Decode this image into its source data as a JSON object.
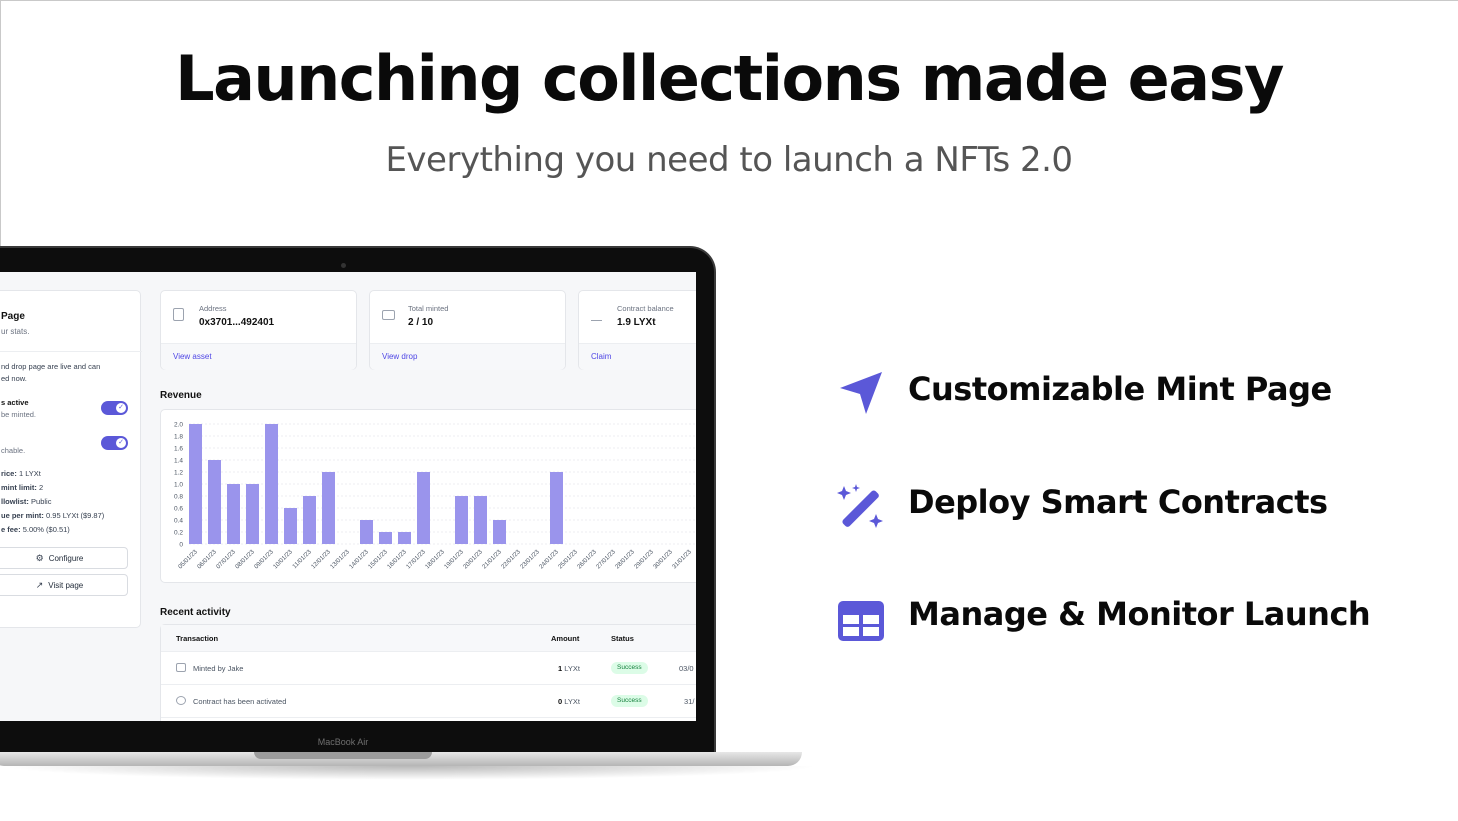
{
  "hero": {
    "title": "Launching collections made easy",
    "subtitle": "Everything you need to launch a NFTs 2.0"
  },
  "features": [
    {
      "label": "Customizable Mint Page",
      "icon": "navigation-arrow-icon"
    },
    {
      "label": "Deploy Smart Contracts",
      "icon": "magic-wand-icon"
    },
    {
      "label": "Manage & Monitor Launch",
      "icon": "grid-table-icon"
    }
  ],
  "colors": {
    "accent": "#5b58d8",
    "chart_bar": "#9a94ec",
    "link": "#4f46e5",
    "success_bg": "#dcfce7",
    "success_text": "#15803d"
  },
  "laptop": {
    "brand": "MacBook Air",
    "sidebar": {
      "title": "Page",
      "subtitle": "ur stats.",
      "intro_line1": "nd drop page are live and can",
      "intro_line2": "ed now.",
      "toggle1_label": "s active",
      "toggle1_sub": "be minted.",
      "toggle2_sub": "chable.",
      "price_key": "rice:",
      "price_val": "1 LYXt",
      "mint_limit_key": "mint limit:",
      "mint_limit_val": "2",
      "allowlist_key": "llowlist:",
      "allowlist_val": "Public",
      "revenue_key": "ue per mint:",
      "revenue_val": "0.95 LYXt ($9.87)",
      "fee_key": "e fee:",
      "fee_val": "5.00% ($0.51)",
      "configure_label": "Configure",
      "visit_label": "Visit page"
    },
    "stats": [
      {
        "label": "Address",
        "value": "0x3701...492401",
        "link": "View asset"
      },
      {
        "label": "Total minted",
        "value": "2 / 10",
        "link": "View drop"
      },
      {
        "label": "Contract balance",
        "value": "1.9 LYXt",
        "link": "Claim"
      }
    ],
    "revenue_title": "Revenue",
    "activity": {
      "title": "Recent activity",
      "headers": {
        "transaction": "Transaction",
        "amount": "Amount",
        "status": "Status"
      },
      "rows": [
        {
          "desc": "Minted by Jake",
          "amount_num": "1",
          "amount_unit": "LYXt",
          "status": "Success",
          "date": "03/0"
        },
        {
          "desc": "Contract has been activated",
          "amount_num": "0",
          "amount_unit": "LYXt",
          "status": "Success",
          "date": "31/"
        }
      ]
    }
  },
  "chart_data": {
    "type": "bar",
    "title": "Revenue",
    "categories": [
      "05/01/23",
      "06/01/23",
      "07/01/23",
      "08/01/23",
      "09/01/23",
      "10/01/23",
      "11/01/23",
      "12/01/23",
      "13/01/23",
      "14/01/23",
      "15/01/23",
      "16/01/23",
      "17/01/23",
      "18/01/23",
      "19/01/23",
      "20/01/23",
      "21/01/23",
      "22/01/23",
      "23/01/23",
      "24/01/23",
      "25/01/23",
      "26/01/23",
      "27/01/23",
      "28/01/23",
      "29/01/23",
      "30/01/23",
      "31/01/23"
    ],
    "values": [
      2.0,
      1.4,
      1.0,
      1.0,
      2.0,
      0.6,
      0.8,
      1.2,
      0,
      0.4,
      0.2,
      0.2,
      1.2,
      0,
      0.8,
      0.8,
      0.4,
      0,
      0,
      1.2,
      0,
      0,
      0,
      0,
      0,
      0,
      0
    ],
    "yticks": [
      "2.0",
      "1.8",
      "1.6",
      "1.4",
      "1.2",
      "1.0",
      "0.8",
      "0.6",
      "0.4",
      "0.2",
      "0"
    ],
    "ylim": [
      0,
      2.0
    ],
    "grid": true,
    "xlabel": "",
    "ylabel": ""
  }
}
